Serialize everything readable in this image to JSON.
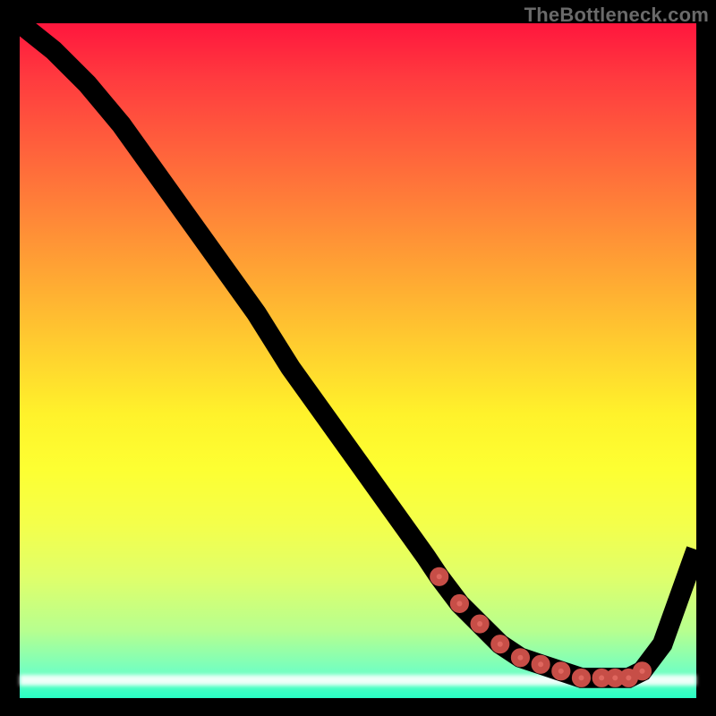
{
  "watermark": "TheBottleneck.com",
  "chart_data": {
    "type": "line",
    "title": "",
    "xlabel": "",
    "ylabel": "",
    "xlim": [
      0,
      100
    ],
    "ylim": [
      0,
      100
    ],
    "series": [
      {
        "name": "curve",
        "x": [
          0,
          5,
          10,
          15,
          20,
          25,
          30,
          35,
          40,
          45,
          50,
          55,
          60,
          62,
          65,
          68,
          71,
          74,
          77,
          80,
          83,
          86,
          88,
          90,
          92,
          95,
          100
        ],
        "y": [
          100,
          96,
          91,
          85,
          78,
          71,
          64,
          57,
          49,
          42,
          35,
          28,
          21,
          18,
          14,
          11,
          8,
          6,
          5,
          4,
          3,
          3,
          3,
          3,
          4,
          8,
          22
        ]
      }
    ],
    "markers": {
      "name": "highlight-band",
      "x": [
        62,
        65,
        68,
        71,
        74,
        77,
        80,
        83,
        86,
        88,
        90,
        92
      ],
      "y": [
        18,
        14,
        11,
        8,
        6,
        5,
        4,
        3,
        3,
        3,
        3,
        4
      ]
    },
    "background": {
      "type": "vertical-gradient",
      "stops": [
        "#ff163d",
        "#fff22b",
        "#28ffc4"
      ]
    }
  }
}
